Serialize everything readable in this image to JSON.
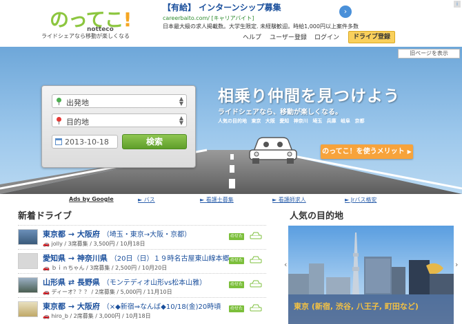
{
  "header": {
    "logo_text": "のってこ",
    "logo_excl": "!",
    "logo_sub": "notteco",
    "tagline": "ライドシェアなら移動が楽しくなる",
    "ad": {
      "title": "【有給】 インターンシップ募集",
      "url": "careerbaito.com/ [キャリアバイト]",
      "desc": "日本最大級の求人掲載数。大学生限定. 未経験歓迎。時給1,000円以上案件多数",
      "choice_icon": "i"
    },
    "nav": {
      "help": "ヘルプ",
      "register": "ユーザー登録",
      "login": "ログイン",
      "drive_register": "ドライブ登録"
    }
  },
  "hero": {
    "old_page_label": "旧ページを表示",
    "search": {
      "from_placeholder": "出発地",
      "to_placeholder": "目的地",
      "date_value": "2013-10-18",
      "search_button": "検索"
    },
    "title": "相乗り仲間を見つけよう",
    "subtitle": "ライドシェアなら、移動が楽しくなる。",
    "popular_label": "人気の目的地",
    "popular_places": [
      "東京",
      "大阪",
      "愛知",
      "神奈川",
      "埼玉",
      "兵庫",
      "岐阜",
      "京都"
    ],
    "merit_button": "のってこ！を使うメリット"
  },
  "ad_links": {
    "ads_by": "Ads by Google",
    "links": [
      "► バス",
      "► 看護士募集",
      "► 看護師求人",
      "► Jrバス格安"
    ]
  },
  "new_drives": {
    "title": "新着ドライブ",
    "ride_badge": "のせたい",
    "rows": [
      {
        "route": "東京都 → 大阪府",
        "note": "（埼玉・東京→大阪・京都）",
        "meta": "jolly / 3席募集 / 3,500円 / 10月18日"
      },
      {
        "route": "愛知県 → 神奈川県",
        "note": "（20日（日）１９時名古屋東山線本郷...",
        "meta": "ｂｉｎちゃん / 3席募集 / 2,500円 / 10月20日"
      },
      {
        "route": "山形県 ⇄ 長野県",
        "note": "（モンテディオ山形vs松本山雅）",
        "meta": "ディーオ？？？ / 2席募集 / 5,000円 / 11月10日"
      },
      {
        "route": "東京都 → 大阪府",
        "note": "（×◆新宿⇒なんば◆10/18(金)20時頃",
        "meta": "hiro_b / 2席募集 / 3,000円 / 10月18日"
      }
    ]
  },
  "popular": {
    "title": "人気の目的地",
    "caption": "東京 (新宿, 渋谷, 八王子, 町田など)"
  },
  "colors": {
    "accent_green": "#8cc63f",
    "link_blue": "#1a4f9c",
    "orange": "#f7a33b",
    "sky": "#6ea7d9"
  }
}
